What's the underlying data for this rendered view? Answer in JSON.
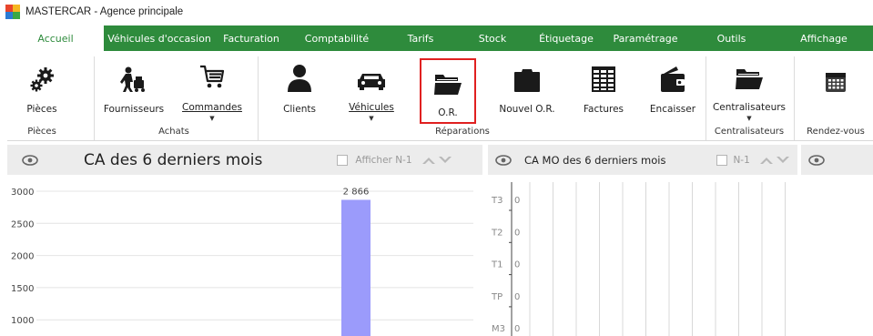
{
  "window": {
    "title": "MASTERCAR - Agence principale"
  },
  "menu": {
    "tabs": [
      {
        "label": "Accueil",
        "active": true
      },
      {
        "label": "Véhicules d'occasion"
      },
      {
        "label": "Facturation"
      },
      {
        "label": "Comptabilité"
      },
      {
        "label": "Tarifs"
      },
      {
        "label": "Stock"
      },
      {
        "label": "Étiquetage"
      },
      {
        "label": "Paramétrage"
      },
      {
        "label": "Outils"
      },
      {
        "label": "Affichage"
      }
    ]
  },
  "ribbon": {
    "buttons": {
      "pieces": {
        "label": "Pièces",
        "icon": "gears-icon"
      },
      "fournisseurs": {
        "label": "Fournisseurs",
        "icon": "delivery-person-icon"
      },
      "commandes": {
        "label": "Commandes",
        "icon": "cart-icon"
      },
      "clients": {
        "label": "Clients",
        "icon": "person-icon"
      },
      "vehicules": {
        "label": "Véhicules",
        "icon": "car-icon"
      },
      "or": {
        "label": "O.R.",
        "icon": "open-folder-icon"
      },
      "nouvel_or": {
        "label": "Nouvel O.R.",
        "icon": "folder-icon"
      },
      "factures": {
        "label": "Factures",
        "icon": "table-icon"
      },
      "encaisser": {
        "label": "Encaisser",
        "icon": "wallet-icon"
      },
      "centralisateurs": {
        "label": "Centralisateurs",
        "icon": "open-folder-icon"
      },
      "rendezvous": {
        "label": "",
        "icon": "calendar-icon"
      }
    },
    "groups": {
      "pieces": "Pièces",
      "achats": "Achats",
      "reparations": "Réparations",
      "centralisateurs": "Centralisateurs",
      "rendezvous": "Rendez-vous"
    }
  },
  "panels": {
    "left": {
      "title": "CA des 6 derniers mois",
      "checkbox_label": "Afficher N-1"
    },
    "right": {
      "title": "CA MO des 6 derniers mois",
      "checkbox_label": "N-1"
    }
  },
  "chart_data": [
    {
      "type": "bar",
      "title": "CA des 6 derniers mois",
      "y_ticks": [
        3000,
        2500,
        2000,
        1500,
        1000
      ],
      "ylim": [
        1000,
        3000
      ],
      "visible_bars": [
        {
          "value": 2866,
          "label": "2 866"
        }
      ],
      "bar_color": "#9b9bfb",
      "grid": true
    },
    {
      "type": "bar",
      "title": "CA MO des 6 derniers mois",
      "categories": [
        "T3",
        "T2",
        "T1",
        "TP",
        "M3"
      ],
      "values": [
        0,
        0,
        0,
        0,
        0
      ],
      "value_labels": [
        "0",
        "0",
        "0",
        "0",
        "0"
      ],
      "grid": true
    }
  ],
  "colors": {
    "menu_bg": "#2e8b3c",
    "highlight": "#e02020",
    "bar": "#9b9bfb"
  }
}
